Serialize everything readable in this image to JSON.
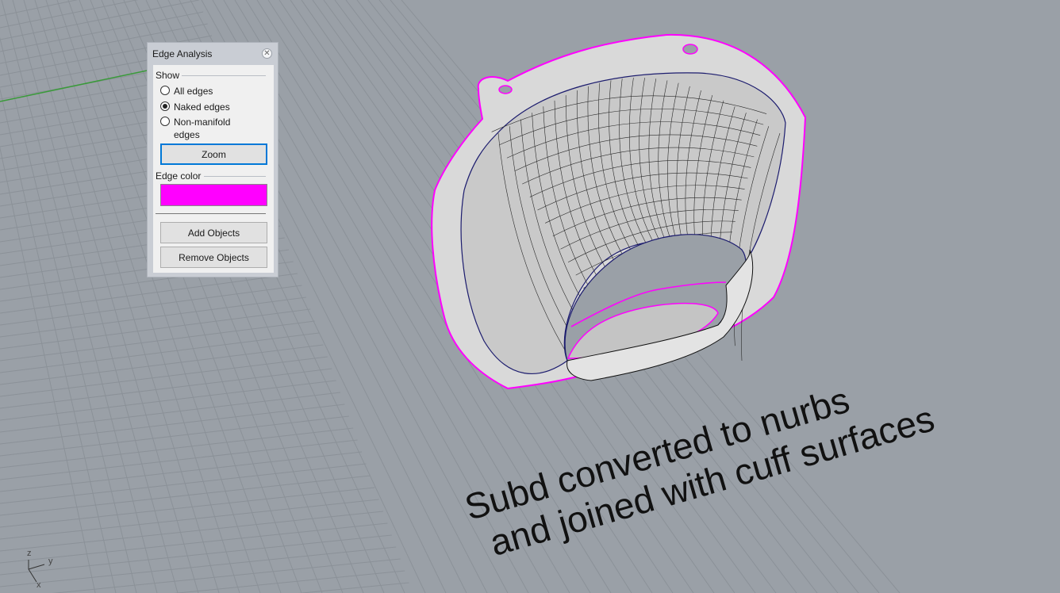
{
  "panel": {
    "title": "Edge Analysis",
    "close_glyph": "✕",
    "show_label": "Show",
    "radios": [
      {
        "label": "All edges",
        "selected": false
      },
      {
        "label": "Naked edges",
        "selected": true
      },
      {
        "label": "Non-manifold edges",
        "selected": false
      }
    ],
    "zoom_label": "Zoom",
    "edge_color_label": "Edge color",
    "edge_color": "#ff00ff",
    "add_objects_label": "Add Objects",
    "remove_objects_label": "Remove Objects"
  },
  "viewport": {
    "caption_line1": "Subd converted to nurbs",
    "caption_line2": "and joined with cuff surfaces",
    "axis_z": "z",
    "axis_y": "y",
    "axis_x": "x",
    "colors": {
      "background": "#9aa0a7",
      "grid": "#8d939a",
      "naked_edge": "#ff00ff",
      "green_axis": "#3a9a3a",
      "surface": "#e6e6e6"
    }
  }
}
